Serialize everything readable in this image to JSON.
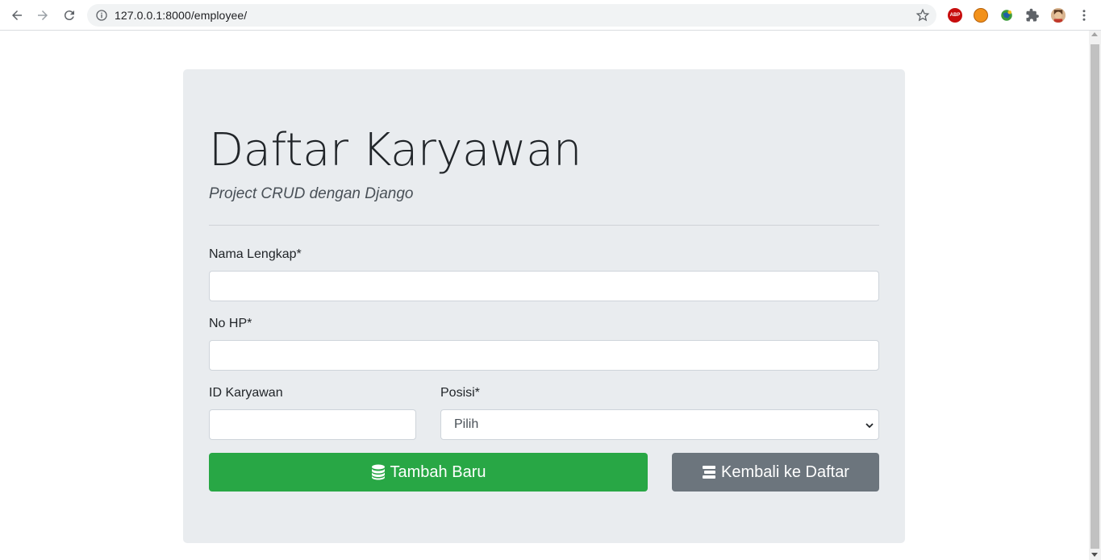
{
  "browser": {
    "url": "127.0.0.1:8000/employee/",
    "extensions": [
      "adblock-plus",
      "orange-ext",
      "globe-ext",
      "puzzle-icon",
      "profile-avatar"
    ]
  },
  "page": {
    "title": "Daftar Karyawan",
    "subtitle": "Project CRUD dengan Django"
  },
  "form": {
    "nama_label": "Nama Lengkap*",
    "nama_value": "",
    "nohp_label": "No HP*",
    "nohp_value": "",
    "idkaryawan_label": "ID Karyawan",
    "idkaryawan_value": "",
    "posisi_label": "Posisi*",
    "posisi_selected": "Pilih"
  },
  "buttons": {
    "submit_label": "Tambah Baru",
    "back_label": "Kembali ke Daftar"
  },
  "colors": {
    "success": "#28a745",
    "secondary": "#6c757d",
    "jumbotron": "#e9ecef"
  }
}
